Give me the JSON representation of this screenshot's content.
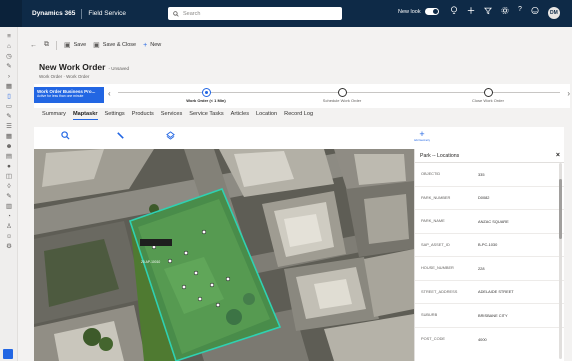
{
  "topbar": {
    "app_name": "Dynamics 365",
    "area_name": "Field Service",
    "search_placeholder": "Search",
    "new_look_label": "New look",
    "avatar_initials": "DM"
  },
  "commands": {
    "save_label": "Save",
    "save_close_label": "Save & Close",
    "new_label": "New"
  },
  "header": {
    "title": "New Work Order",
    "unsaved": "- Unsaved",
    "subtitle": "Work Order · Work Order"
  },
  "bpf": {
    "stage_name": "Work Order Business Pro...",
    "stage_sub": "Active for less than one minute",
    "stages": [
      {
        "label": "Work Order (< 1 Min)",
        "active": true
      },
      {
        "label": "Schedule Work Order",
        "active": false
      },
      {
        "label": "Close Work Order",
        "active": false
      }
    ]
  },
  "tabs": [
    "Summary",
    "Maptaskr",
    "Settings",
    "Products",
    "Services",
    "Service Tasks",
    "Articles",
    "Location",
    "Record Log"
  ],
  "active_tab": "Maptaskr",
  "map": {
    "tool_icons": [
      "search-icon",
      "pencil-icon",
      "layers-icon"
    ],
    "add_tool_caption": "Add Geometry",
    "parcel_label": "20.AP-10010"
  },
  "panel": {
    "title": "Park -- Locations",
    "rows": [
      {
        "key": "OBJECTID",
        "value": "335"
      },
      {
        "key": "PARK_NUMBER",
        "value": "D0082"
      },
      {
        "key": "PARK_NAME",
        "value": "ANZAC SQUARE"
      },
      {
        "key": "SAP_ASSET_ID",
        "value": "B-PC-1030"
      },
      {
        "key": "HOUSE_NUMBER",
        "value": "228"
      },
      {
        "key": "STREET_ADDRESS",
        "value": "ADELAIDE STREET"
      },
      {
        "key": "SUBURB",
        "value": "BRISBANE CITY"
      },
      {
        "key": "POST_CODE",
        "value": "4000"
      }
    ]
  },
  "colors": {
    "topbar": "#0e2a47",
    "accent": "#2266e3",
    "parcel_outline": "#2fd1b2"
  }
}
